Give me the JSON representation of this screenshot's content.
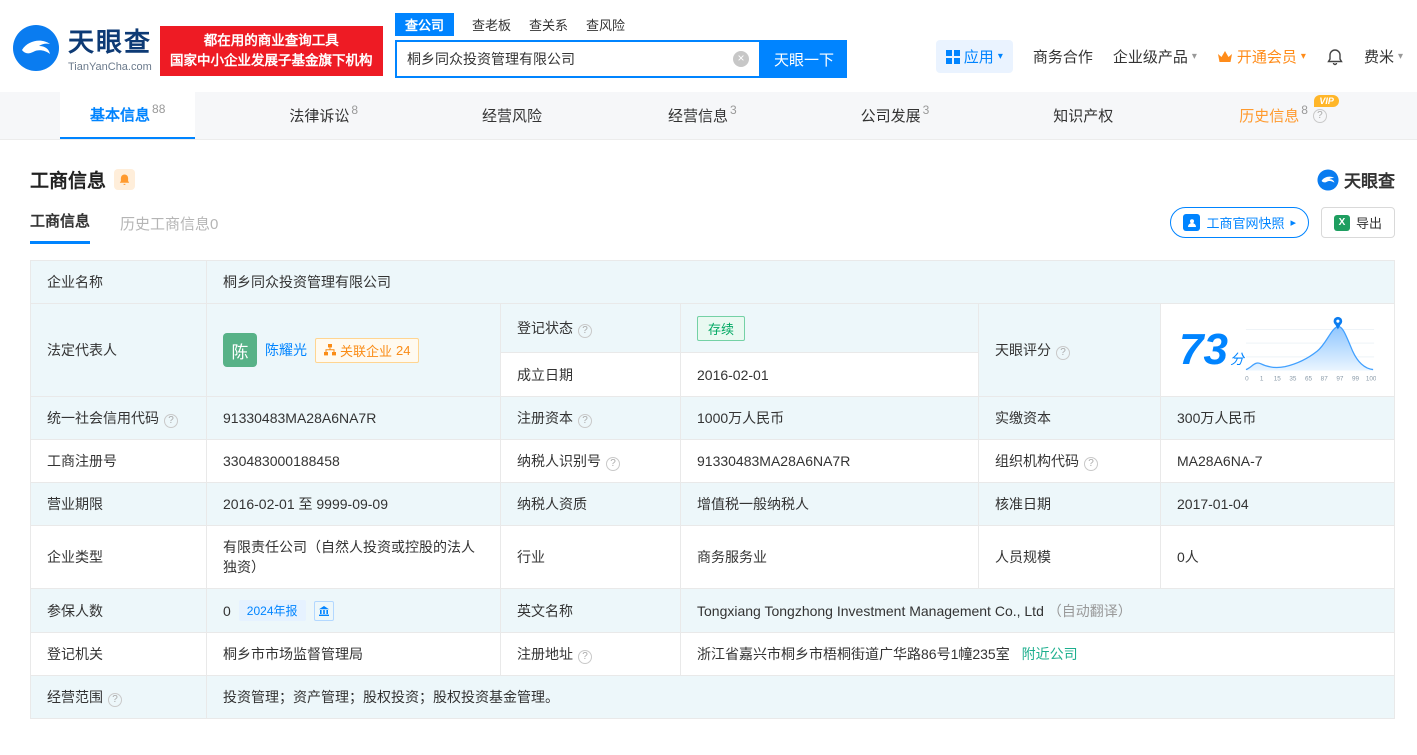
{
  "colors": {
    "brand_blue": "#0084ff",
    "banner_red": "#ee1b24",
    "vip_orange": "#ff8c1a",
    "status_green": "#00a862",
    "nearby_green": "#1daf8e"
  },
  "brand": {
    "name": "天眼查",
    "domain": "TianYanCha.com",
    "slogan1": "都在用的商业查询工具",
    "slogan2": "国家中小企业发展子基金旗下机构"
  },
  "search": {
    "tabs": [
      {
        "label": "查公司"
      },
      {
        "label": "查老板"
      },
      {
        "label": "查关系"
      },
      {
        "label": "查风险"
      }
    ],
    "value": "桐乡同众投资管理有限公司",
    "submit": "天眼一下"
  },
  "topmenu": {
    "apps": "应用",
    "cooperation": "商务合作",
    "enterprise": "企业级产品",
    "vip": "开通会员",
    "user": "费米"
  },
  "nav": {
    "vip_tag": "VIP",
    "tabs": [
      {
        "label": "基本信息",
        "count": "88"
      },
      {
        "label": "法律诉讼",
        "count": "8"
      },
      {
        "label": "经营风险",
        "count": ""
      },
      {
        "label": "经营信息",
        "count": "3"
      },
      {
        "label": "公司发展",
        "count": "3"
      },
      {
        "label": "知识产权",
        "count": ""
      },
      {
        "label": "历史信息",
        "count": "8"
      }
    ]
  },
  "section": {
    "title": "工商信息",
    "brand": "天眼查",
    "subtab_active": "工商信息",
    "subtab_history": "历史工商信息0",
    "snapshot": "工商官网快照",
    "export": "导出"
  },
  "biz": {
    "name_label": "企业名称",
    "name": "桐乡同众投资管理有限公司",
    "legal_label": "法定代表人",
    "avatar": "陈",
    "legal_name": "陈耀光",
    "related": "关联企业",
    "related_count": "24",
    "status_label": "登记状态",
    "status": "存续",
    "date_label": "成立日期",
    "date": "2016-02-01",
    "score_label": "天眼评分",
    "score": "73",
    "score_unit": "分",
    "credit_label": "统一社会信用代码",
    "credit": "91330483MA28A6NA7R",
    "regcap_label": "注册资本",
    "regcap": "1000万人民币",
    "paidcap_label": "实缴资本",
    "paidcap": "300万人民币",
    "regno_label": "工商注册号",
    "regno": "330483000188458",
    "taxno_label": "纳税人识别号",
    "taxno": "91330483MA28A6NA7R",
    "orgcode_label": "组织机构代码",
    "orgcode": "MA28A6NA-7",
    "term_label": "营业期限",
    "term": "2016-02-01 至 9999-09-09",
    "taxq_label": "纳税人资质",
    "taxq": "增值税一般纳税人",
    "approve_label": "核准日期",
    "approve": "2017-01-04",
    "type_label": "企业类型",
    "type": "有限责任公司（自然人投资或控股的法人独资）",
    "industry_label": "行业",
    "industry": "商务服务业",
    "staff_label": "人员规模",
    "staff": "0人",
    "insured_label": "参保人数",
    "insured": "0",
    "annual_badge": "2024年报",
    "en_label": "英文名称",
    "en_name": "Tongxiang Tongzhong Investment Management Co., Ltd",
    "auto_translate": "（自动翻译）",
    "authority_label": "登记机关",
    "authority": "桐乡市市场监督管理局",
    "address_label": "注册地址",
    "address": "浙江省嘉兴市桐乡市梧桐街道广华路86号1幢235室",
    "nearby": "附近公司",
    "scope_label": "经营范围",
    "scope": "投资管理；资产管理；股权投资；股权投资基金管理。"
  },
  "score_chart": {
    "ticks": [
      "0",
      "1",
      "15",
      "35",
      "65",
      "87",
      "97",
      "99",
      "100"
    ]
  }
}
